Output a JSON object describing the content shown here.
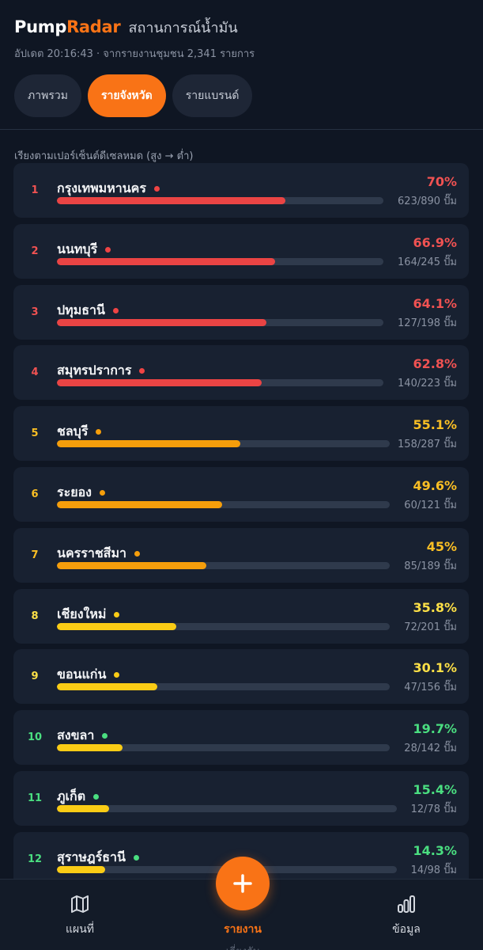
{
  "header": {
    "brand_part1": "Pump",
    "brand_part2": "Radar",
    "subtitle": "สถานการณ์น้ำมัน",
    "updated": "อัปเดต 20:16:43 · จากรายงานชุมชน 2,341 รายการ"
  },
  "tabs": [
    {
      "label": "ภาพรวม",
      "active": false
    },
    {
      "label": "รายจังหวัด",
      "active": true
    },
    {
      "label": "รายแบรนด์",
      "active": false
    }
  ],
  "sort_note": "เรียงตามเปอร์เซ็นต์ดีเซลหมด (สูง → ต่ำ)",
  "provinces": [
    {
      "rank": "1",
      "name": "กรุงเทพมหานคร",
      "percent_label": "70%",
      "percent": 70,
      "count": "623/890 ปั๊ม",
      "level": "red"
    },
    {
      "rank": "2",
      "name": "นนทบุรี",
      "percent_label": "66.9%",
      "percent": 66.9,
      "count": "164/245 ปั๊ม",
      "level": "red"
    },
    {
      "rank": "3",
      "name": "ปทุมธานี",
      "percent_label": "64.1%",
      "percent": 64.1,
      "count": "127/198 ปั๊ม",
      "level": "red"
    },
    {
      "rank": "4",
      "name": "สมุทรปราการ",
      "percent_label": "62.8%",
      "percent": 62.8,
      "count": "140/223 ปั๊ม",
      "level": "red"
    },
    {
      "rank": "5",
      "name": "ชลบุรี",
      "percent_label": "55.1%",
      "percent": 55.1,
      "count": "158/287 ปั๊ม",
      "level": "orange"
    },
    {
      "rank": "6",
      "name": "ระยอง",
      "percent_label": "49.6%",
      "percent": 49.6,
      "count": "60/121 ปั๊ม",
      "level": "orange"
    },
    {
      "rank": "7",
      "name": "นครราชสีมา",
      "percent_label": "45%",
      "percent": 45,
      "count": "85/189 ปั๊ม",
      "level": "orange"
    },
    {
      "rank": "8",
      "name": "เชียงใหม่",
      "percent_label": "35.8%",
      "percent": 35.8,
      "count": "72/201 ปั๊ม",
      "level": "yellow"
    },
    {
      "rank": "9",
      "name": "ขอนแก่น",
      "percent_label": "30.1%",
      "percent": 30.1,
      "count": "47/156 ปั๊ม",
      "level": "yellow"
    },
    {
      "rank": "10",
      "name": "สงขลา",
      "percent_label": "19.7%",
      "percent": 19.7,
      "count": "28/142 ปั๊ม",
      "level": "green"
    },
    {
      "rank": "11",
      "name": "ภูเก็ต",
      "percent_label": "15.4%",
      "percent": 15.4,
      "count": "12/78 ปั๊ม",
      "level": "green"
    },
    {
      "rank": "12",
      "name": "สุราษฎร์ธานี",
      "percent_label": "14.3%",
      "percent": 14.3,
      "count": "14/98 ปั๊ม",
      "level": "green"
    }
  ],
  "level_colors": {
    "red": {
      "text": "#f05252",
      "bar": "#ea4444",
      "dot": "#ef4444"
    },
    "orange": {
      "text": "#fbbf24",
      "bar": "#f59e0b",
      "dot": "#f59e0b"
    },
    "yellow": {
      "text": "#fde047",
      "bar": "#facc15",
      "dot": "#facc15"
    },
    "green": {
      "text": "#4ade80",
      "bar": "#facc15",
      "dot": "#4ade80"
    }
  },
  "nav": {
    "map_label": "แผนที่",
    "report_label": "รายงาน",
    "report_sub": "เลี่ยงกับ",
    "data_label": "ข้อมูล",
    "map_icon": "map-icon",
    "data_icon": "bar-chart-icon",
    "add_icon": "plus-icon"
  }
}
